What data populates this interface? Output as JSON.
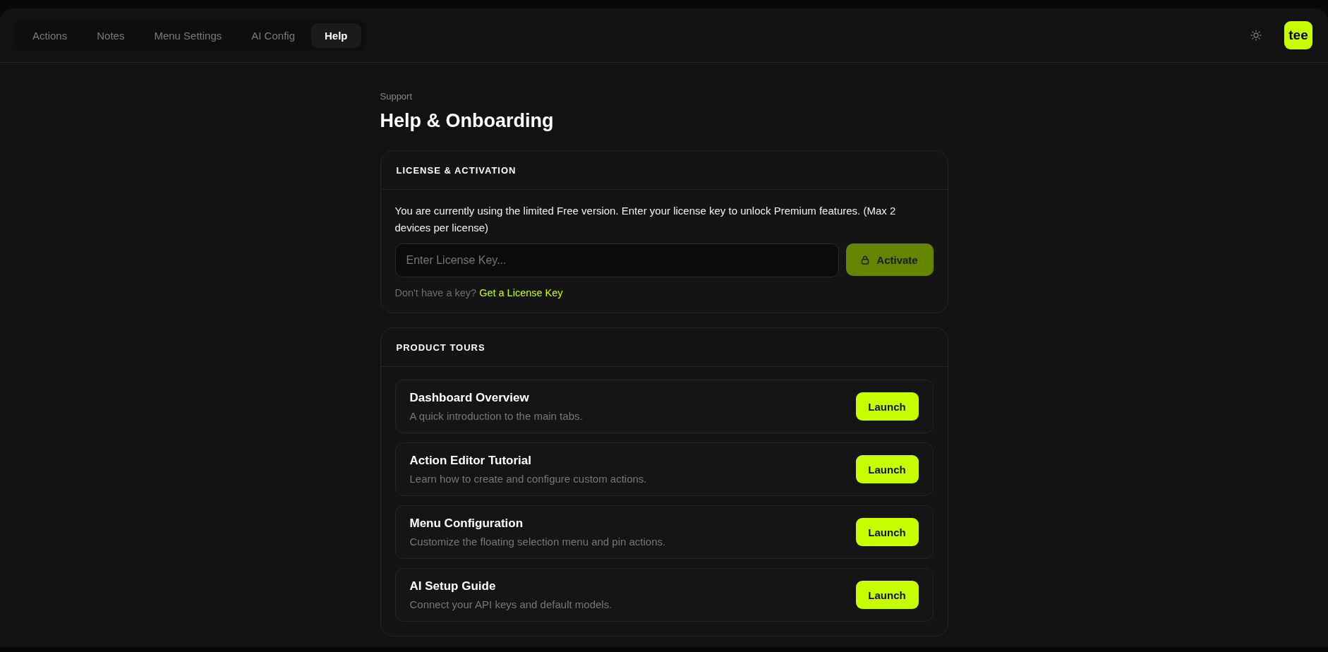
{
  "tabs": [
    {
      "label": "Actions",
      "selected": false
    },
    {
      "label": "Notes",
      "selected": false
    },
    {
      "label": "Menu Settings",
      "selected": false
    },
    {
      "label": "AI Config",
      "selected": false
    },
    {
      "label": "Help",
      "selected": true
    }
  ],
  "header": {
    "avatar": "tee"
  },
  "page": {
    "eyebrow": "Support",
    "title": "Help & Onboarding"
  },
  "license": {
    "heading": "LICENSE & ACTIVATION",
    "description": "You are currently using the limited Free version. Enter your license key to unlock Premium features. (Max 2 devices per license)",
    "placeholder": "Enter License Key...",
    "button": "Activate",
    "hint": "Don't have a key?",
    "link": "Get a License Key"
  },
  "tours": {
    "heading": "PRODUCT TOURS",
    "items": [
      {
        "title": "Dashboard Overview",
        "description": "A quick introduction to the main tabs.",
        "button": "Launch"
      },
      {
        "title": "Action Editor Tutorial",
        "description": "Learn how to create and configure custom actions.",
        "button": "Launch"
      },
      {
        "title": "Menu Configuration",
        "description": "Customize the floating selection menu and pin actions.",
        "button": "Launch"
      },
      {
        "title": "AI Setup Guide",
        "description": "Connect your API keys and default models.",
        "button": "Launch"
      }
    ]
  }
}
